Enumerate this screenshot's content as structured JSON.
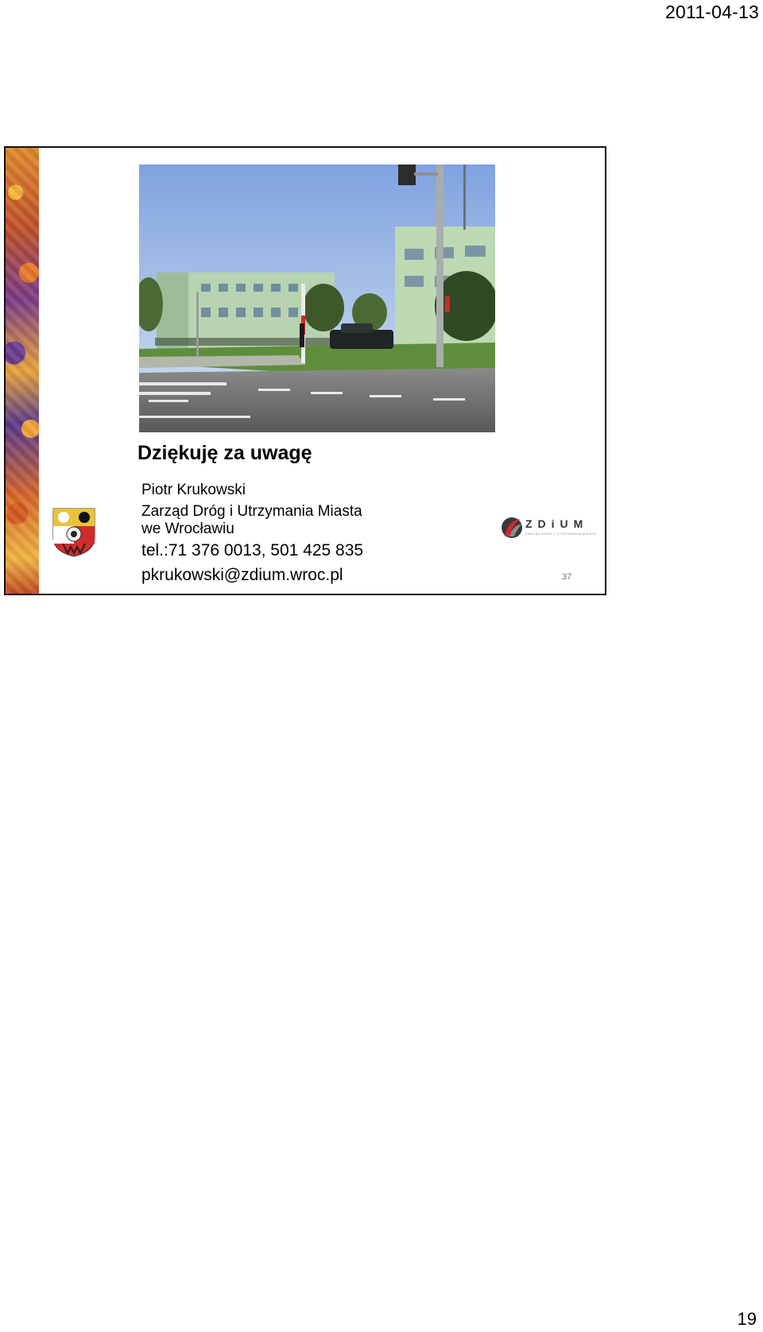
{
  "page": {
    "date": "2011-04-13",
    "number": "19"
  },
  "slide": {
    "title": "Dziękuję za uwagę",
    "contact": {
      "name": "Piotr Krukowski",
      "organization_line1": "Zarząd Dróg i Utrzymania Miasta",
      "organization_line2": "we Wrocławiu",
      "phone": "tel.:71 376 0013, 501 425 835",
      "email": "pkrukowski@zdium.wroc.pl"
    },
    "logo": {
      "brand": "ZDiUM",
      "tagline": "ZARZĄD DRÓG I UTRZYMANIA MIASTA"
    },
    "slide_number": "37",
    "photo_alt": "Budynek przy skrzyżowaniu ulic",
    "colors": {
      "sky": "#a8c4ea",
      "building": "#b9d6b0",
      "road": "#6f7070",
      "grass": "#5f8f3a",
      "logo_red": "#d8262c"
    }
  }
}
